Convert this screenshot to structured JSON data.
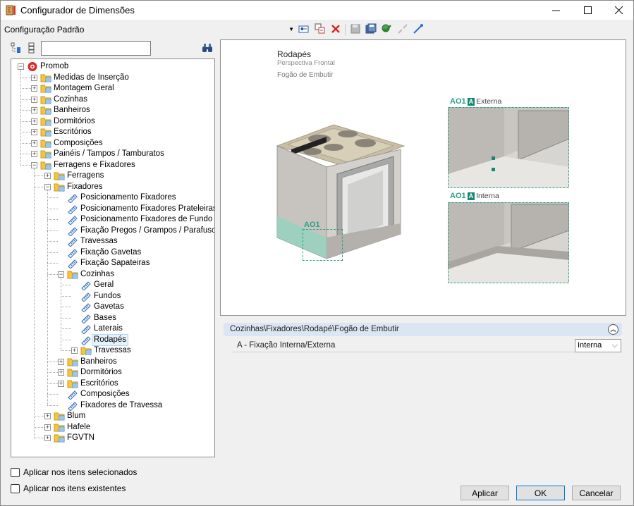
{
  "window": {
    "title": "Configurador de Dimensões"
  },
  "config": {
    "selected": "Configuração Padrão"
  },
  "tree": {
    "items": [
      "Promob",
      "Medidas de Inserção",
      "Montagem Geral",
      "Cozinhas",
      "Banheiros",
      "Dormitórios",
      "Escritórios",
      "Composições",
      "Painéis / Tampos / Tamburatos",
      "Ferragens e Fixadores",
      "Ferragens",
      "Fixadores",
      "Posicionamento Fixadores",
      "Posicionamento Fixadores Prateleiras",
      "Posicionamento Fixadores de Fundo",
      "Fixação Pregos / Grampos / Parafusos",
      "Travessas",
      "Fixação Gavetas",
      "Fixação Sapateiras",
      "Cozinhas",
      "Geral",
      "Fundos",
      "Gavetas",
      "Bases",
      "Laterais",
      "Rodapés",
      "Travessas",
      "Banheiros",
      "Dormitórios",
      "Escritórios",
      "Composições",
      "Fixadores de Travessa",
      "Blum",
      "Hafele",
      "FGVTN"
    ]
  },
  "options": {
    "apply_selected": "Aplicar nos itens selecionados",
    "apply_existing": "Aplicar nos itens existentes"
  },
  "preview": {
    "title": "Rodapés",
    "subtitle": "Perspectiva Frontal",
    "item": "Fogão de Embutir",
    "main_callout": "AO1",
    "detail_top": {
      "code": "AO1",
      "badge": "A",
      "name": "Externa"
    },
    "detail_bottom": {
      "code": "AO1",
      "badge": "A",
      "name": "Interna"
    }
  },
  "properties": {
    "path": "Cozinhas\\Fixadores\\Rodapé\\Fogão de Embutir",
    "row_label": "A - Fixação Interna/Externa",
    "row_value": "Interna"
  },
  "buttons": {
    "apply": "Aplicar",
    "ok": "OK",
    "cancel": "Cancelar"
  },
  "colors": {
    "accent": "#128a6e",
    "callout": "#27a085",
    "header": "#dbe5f3"
  }
}
